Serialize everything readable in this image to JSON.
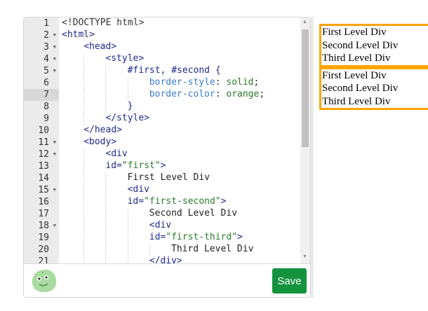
{
  "editor": {
    "active_line": 7,
    "lines": [
      {
        "n": 1,
        "indent": 0,
        "fold": false,
        "tokens": [
          [
            "<!DOCTYPE html>",
            "punc"
          ]
        ]
      },
      {
        "n": 2,
        "indent": 0,
        "fold": true,
        "tokens": [
          [
            "<html>",
            "tag"
          ]
        ]
      },
      {
        "n": 3,
        "indent": 1,
        "fold": true,
        "tokens": [
          [
            "<head>",
            "tag"
          ]
        ]
      },
      {
        "n": 4,
        "indent": 2,
        "fold": true,
        "tokens": [
          [
            "<style>",
            "tag"
          ]
        ]
      },
      {
        "n": 5,
        "indent": 3,
        "fold": true,
        "tokens": [
          [
            "#first, #second {",
            "tag"
          ]
        ]
      },
      {
        "n": 6,
        "indent": 4,
        "fold": false,
        "tokens": [
          [
            "border-style",
            "prop"
          ],
          [
            ": ",
            "punc"
          ],
          [
            "solid",
            "val"
          ],
          [
            ";",
            "punc"
          ]
        ]
      },
      {
        "n": 7,
        "indent": 4,
        "fold": false,
        "tokens": [
          [
            "border-color",
            "prop"
          ],
          [
            ": ",
            "punc"
          ],
          [
            "orange",
            "val"
          ],
          [
            ";",
            "punc"
          ]
        ]
      },
      {
        "n": 8,
        "indent": 3,
        "fold": false,
        "tokens": [
          [
            "}",
            "tag"
          ]
        ]
      },
      {
        "n": 9,
        "indent": 2,
        "fold": false,
        "tokens": [
          [
            "</style>",
            "tag"
          ]
        ]
      },
      {
        "n": 10,
        "indent": 1,
        "fold": false,
        "tokens": [
          [
            "</head>",
            "tag"
          ]
        ]
      },
      {
        "n": 11,
        "indent": 1,
        "fold": true,
        "tokens": [
          [
            "<body>",
            "tag"
          ]
        ]
      },
      {
        "n": 12,
        "indent": 2,
        "fold": true,
        "tokens": [
          [
            "<div",
            "tag"
          ]
        ]
      },
      {
        "n": 13,
        "indent": 2,
        "fold": false,
        "tokens": [
          [
            "id=",
            "tag"
          ],
          [
            "\"first\"",
            "val"
          ],
          [
            ">",
            "tag"
          ]
        ]
      },
      {
        "n": 14,
        "indent": 3,
        "fold": false,
        "tokens": [
          [
            "First Level Div",
            "txt"
          ]
        ]
      },
      {
        "n": 15,
        "indent": 3,
        "fold": true,
        "tokens": [
          [
            "<div",
            "tag"
          ]
        ]
      },
      {
        "n": 16,
        "indent": 3,
        "fold": false,
        "tokens": [
          [
            "id=",
            "tag"
          ],
          [
            "\"first-second\"",
            "val"
          ],
          [
            ">",
            "tag"
          ]
        ]
      },
      {
        "n": 17,
        "indent": 4,
        "fold": false,
        "tokens": [
          [
            "Second Level Div",
            "txt"
          ]
        ]
      },
      {
        "n": 18,
        "indent": 4,
        "fold": true,
        "tokens": [
          [
            "<div",
            "tag"
          ]
        ]
      },
      {
        "n": 19,
        "indent": 4,
        "fold": false,
        "tokens": [
          [
            "id=",
            "tag"
          ],
          [
            "\"first-third\"",
            "val"
          ],
          [
            ">",
            "tag"
          ]
        ]
      },
      {
        "n": 20,
        "indent": 5,
        "fold": false,
        "tokens": [
          [
            "Third Level Div",
            "txt"
          ]
        ]
      },
      {
        "n": 21,
        "indent": 4,
        "fold": false,
        "tokens": [
          [
            "</div>",
            "tag"
          ]
        ]
      }
    ]
  },
  "footer": {
    "save_label": "Save",
    "save_color": "#14933f"
  },
  "preview": {
    "border_color": "orange",
    "boxes": [
      [
        "First Level Div",
        "Second Level Div",
        "Third Level Div"
      ],
      [
        "First Level Div",
        "Second Level Div",
        "Third Level Div"
      ]
    ]
  }
}
